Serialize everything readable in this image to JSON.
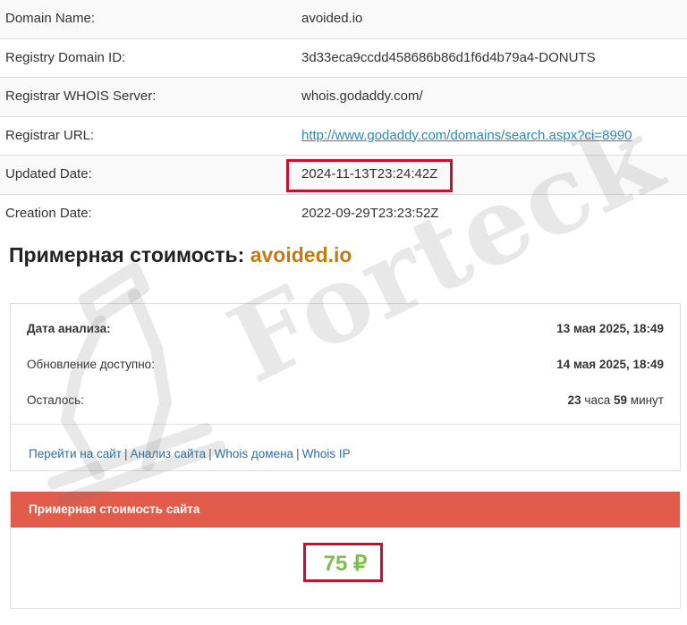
{
  "whois": {
    "rows": [
      {
        "label": "Domain Name:",
        "value": "avoided.io"
      },
      {
        "label": "Registry Domain ID:",
        "value": "3d33eca9ccdd458686b86d1f6d4b79a4-DONUTS"
      },
      {
        "label": "Registrar WHOIS Server:",
        "value": "whois.godaddy.com/"
      },
      {
        "label": "Registrar URL:",
        "value": "http://www.godaddy.com/domains/search.aspx?ci=8990"
      },
      {
        "label": "Updated Date:",
        "value": "2024-11-13T23:24:42Z"
      },
      {
        "label": "Creation Date:",
        "value": "2022-09-29T23:23:52Z"
      }
    ]
  },
  "estimate": {
    "title_prefix": "Примерная стоимость:",
    "domain": "avoided.io"
  },
  "analysis": {
    "date_label": "Дата анализа:",
    "date_value": "13 мая 2025, 18:49",
    "update_label": "Обновление доступно:",
    "update_value": "14 мая 2025, 18:49",
    "left_label": "Осталось:",
    "left_hours": "23",
    "left_hours_unit": "часа",
    "left_minutes": "59",
    "left_minutes_unit": "минут",
    "links": {
      "goto_site": "Перейти на сайт",
      "site_analysis": "Анализ сайта",
      "whois_domain": "Whois домена",
      "whois_ip": "Whois IP",
      "separator": "|"
    }
  },
  "price": {
    "header": "Примерная стоимость сайта",
    "value": "75 ₽"
  },
  "watermark": {
    "text": "Forteck"
  },
  "colors": {
    "highlight": "#c8102e",
    "link": "#2a87b8",
    "domain_accent": "#c47a10",
    "price_header": "#e25c4b",
    "price_value": "#7cc04b"
  }
}
